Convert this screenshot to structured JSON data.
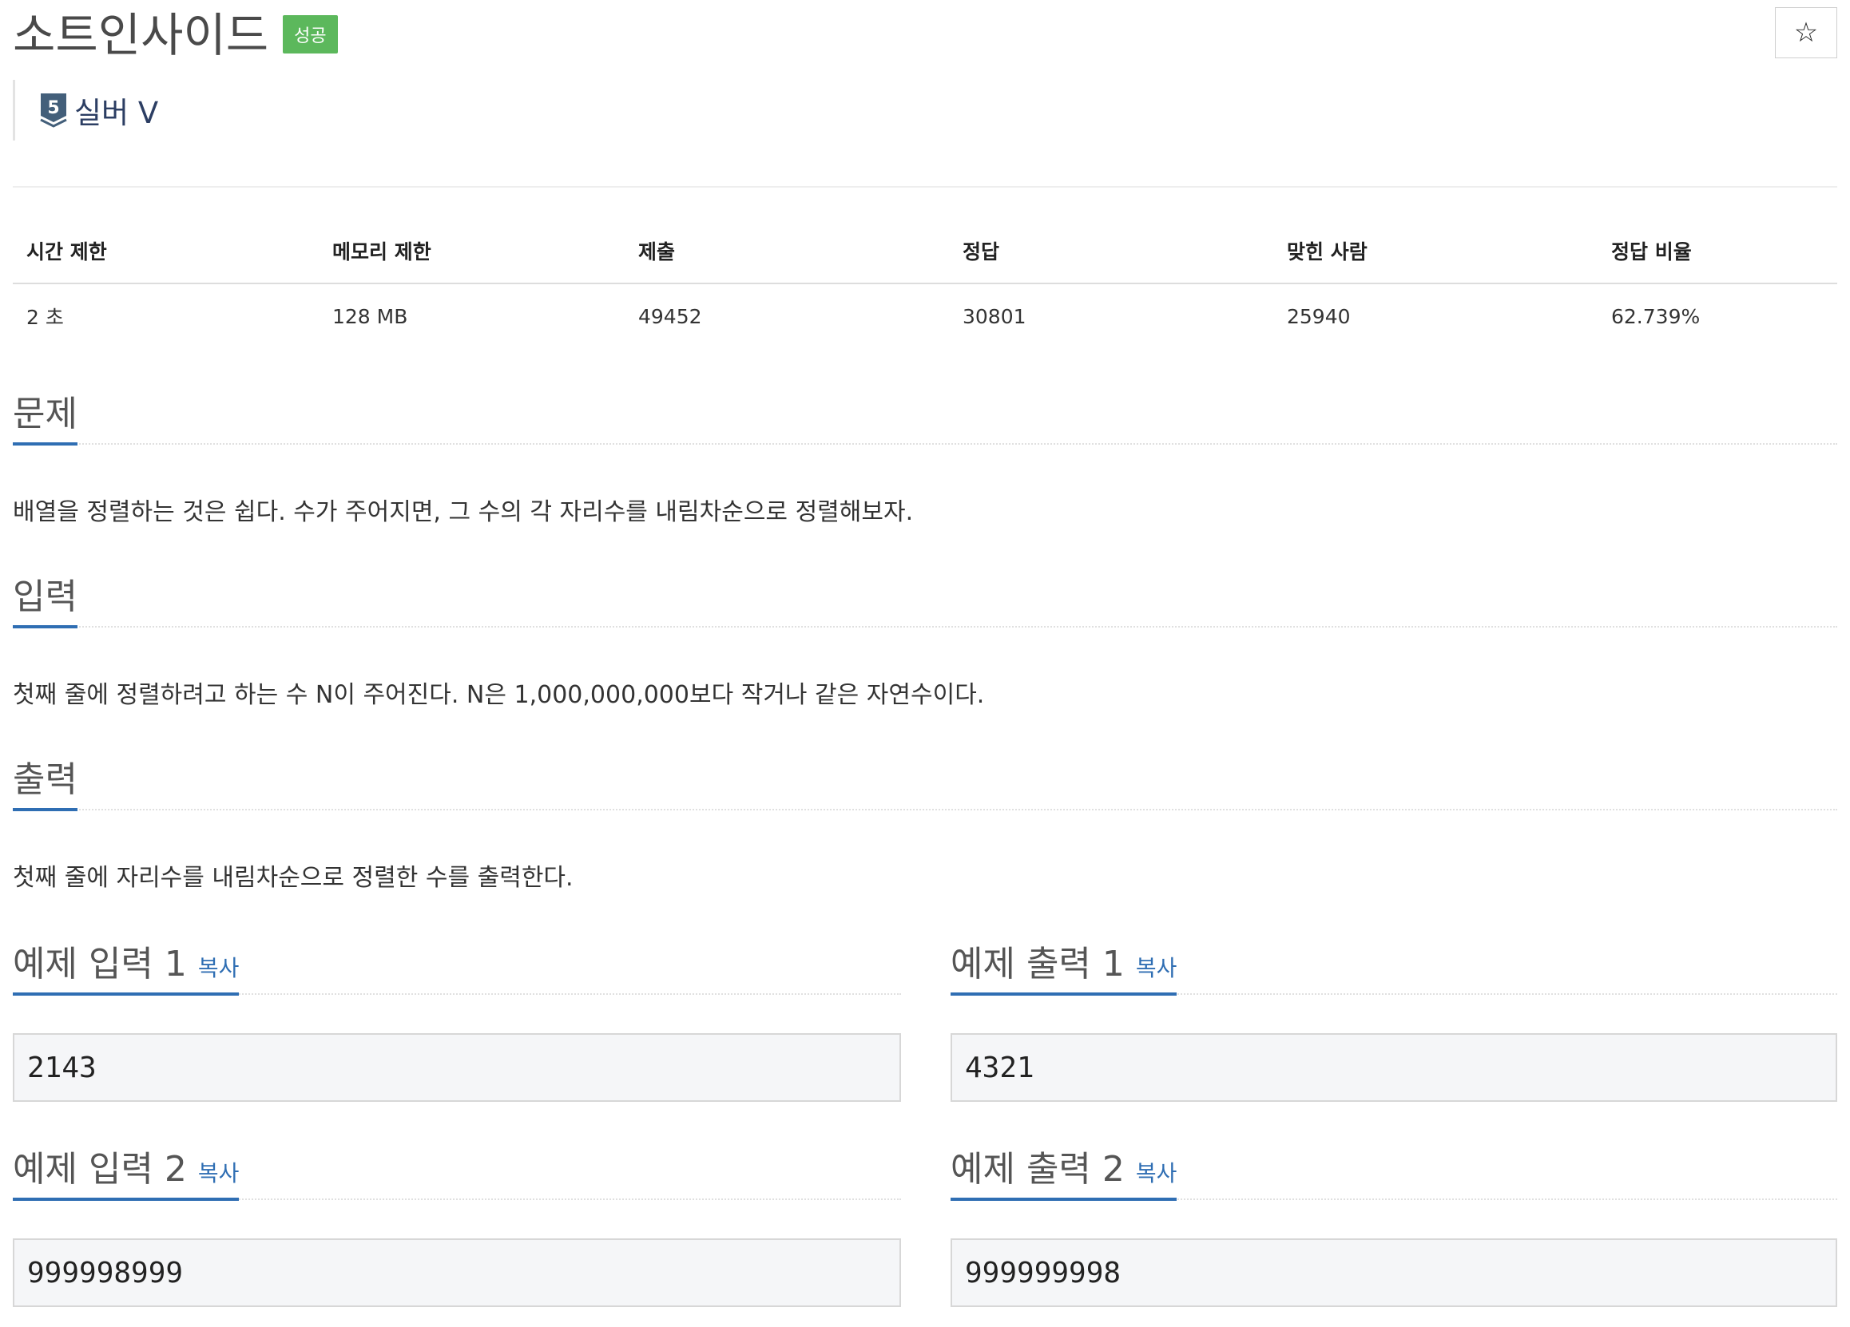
{
  "header": {
    "title": "소트인사이드",
    "status_badge": "성공",
    "star": "☆",
    "tier": {
      "level": "5",
      "label": "실버 V",
      "color": "#435f7a"
    }
  },
  "stats": {
    "headers": [
      "시간 제한",
      "메모리 제한",
      "제출",
      "정답",
      "맞힌 사람",
      "정답 비율"
    ],
    "values": [
      "2 초",
      "128 MB",
      "49452",
      "30801",
      "25940",
      "62.739%"
    ]
  },
  "sections": {
    "problem": {
      "title": "문제",
      "body": "배열을 정렬하는 것은 쉽다. 수가 주어지면, 그 수의 각 자리수를 내림차순으로 정렬해보자."
    },
    "input": {
      "title": "입력",
      "body": "첫째 줄에 정렬하려고 하는 수 N이 주어진다. N은 1,000,000,000보다 작거나 같은 자연수이다."
    },
    "output": {
      "title": "출력",
      "body": "첫째 줄에 자리수를 내림차순으로 정렬한 수를 출력한다."
    }
  },
  "samples": {
    "copy_label": "복사",
    "input1": {
      "title": "예제 입력 1",
      "value": "2143"
    },
    "output1": {
      "title": "예제 출력 1",
      "value": "4321"
    },
    "input2": {
      "title": "예제 입력 2",
      "value": "999998999"
    },
    "output2": {
      "title": "예제 출력 2",
      "value": "999999998"
    }
  },
  "colors": {
    "accent": "#2f6eb3",
    "success": "#5cb85c"
  }
}
